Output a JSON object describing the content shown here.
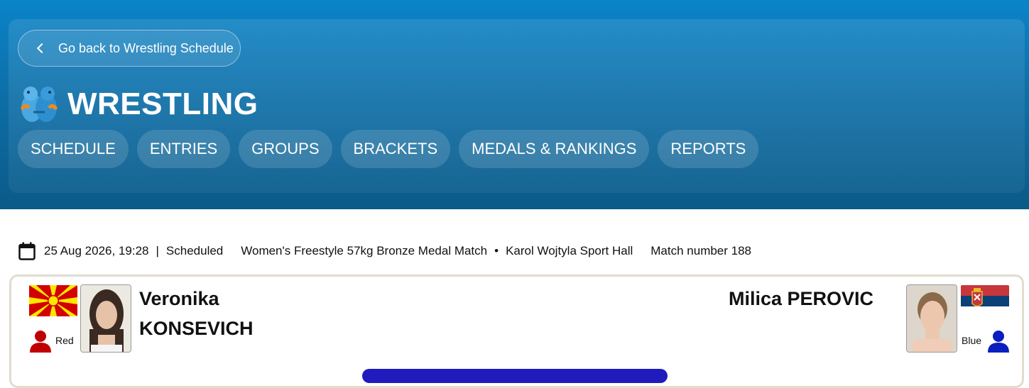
{
  "header": {
    "back_label": "Go back to Wrestling Schedule",
    "sport_title": "WRESTLING",
    "nav": [
      {
        "label": "SCHEDULE"
      },
      {
        "label": "ENTRIES"
      },
      {
        "label": "GROUPS"
      },
      {
        "label": "BRACKETS"
      },
      {
        "label": "MEDALS & RANKINGS"
      },
      {
        "label": "REPORTS"
      }
    ]
  },
  "match": {
    "datetime": "25 Aug 2026, 19:28",
    "separator": "|",
    "status": "Scheduled",
    "event": "Women's Freestyle 57kg Bronze Medal Match",
    "bullet": "•",
    "venue": "Karol Wojtyla Sport Hall",
    "match_number": "Match number 188"
  },
  "red": {
    "name_first": "Veronika",
    "name_last": "KONSEVICH",
    "corner": "Red",
    "color": "#c00000"
  },
  "blue": {
    "name": "Milica PEROVIC",
    "corner": "Blue",
    "color": "#0a1fbf"
  },
  "colors": {
    "header_top": "#0a84c9",
    "header_bottom": "#0b5a88",
    "card_border": "#e2dccf"
  }
}
